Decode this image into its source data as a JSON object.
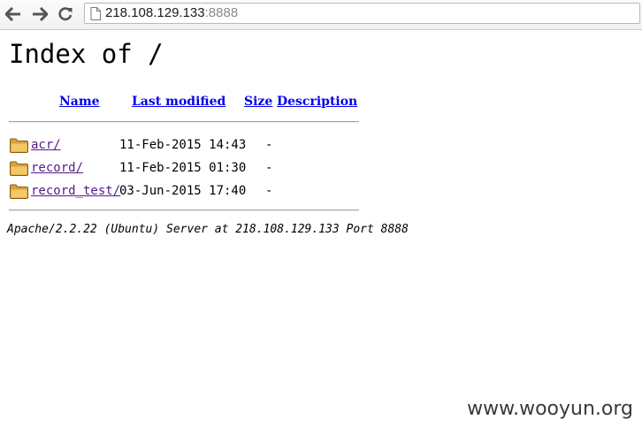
{
  "browser": {
    "url_host": "218.108.129.133",
    "url_port": ":8888",
    "icons": {
      "back": "arrow-left-icon",
      "forward": "arrow-right-icon",
      "reload": "reload-icon",
      "page": "document-icon"
    }
  },
  "page": {
    "title": "Index of /",
    "columns": {
      "name": "Name",
      "last_modified": "Last modified",
      "size": "Size",
      "description": "Description"
    },
    "entries": [
      {
        "name": "acr/",
        "modified": "11-Feb-2015 14:43",
        "size": "-",
        "icon": "folder-icon"
      },
      {
        "name": "record/",
        "modified": "11-Feb-2015 01:30",
        "size": "-",
        "icon": "folder-icon"
      },
      {
        "name": "record_test/",
        "modified": "03-Jun-2015 17:40",
        "size": "-",
        "icon": "folder-icon"
      }
    ],
    "server_signature": "Apache/2.2.22 (Ubuntu) Server at 218.108.129.133 Port 8888"
  },
  "watermark": "www.wooyun.org",
  "colors": {
    "link": "#0000ee",
    "visited_link": "#551a8b",
    "url_port": "#8a8a8a",
    "folder": "#e8b34a"
  }
}
